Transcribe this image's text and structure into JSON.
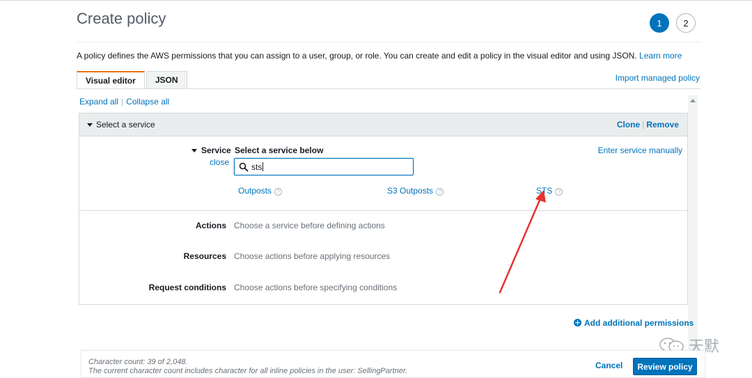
{
  "page": {
    "title": "Create policy",
    "steps": [
      "1",
      "2"
    ],
    "description": "A policy defines the AWS permissions that you can assign to a user, group, or role. You can create and edit a policy in the visual editor and using JSON.",
    "learn_more": "Learn more"
  },
  "tabs": {
    "visual": "Visual editor",
    "json": "JSON"
  },
  "import_link": "Import managed policy",
  "expand": {
    "expand_all": "Expand all",
    "separator": "|",
    "collapse_all": "Collapse all"
  },
  "panel": {
    "header_title": "Select a service",
    "clone": "Clone",
    "separator": "|",
    "remove": "Remove",
    "service_label": "Service",
    "close_link": "close",
    "select_below": "Select a service below",
    "enter_manually": "Enter service manually",
    "search_value": "sts",
    "results": [
      "Outposts",
      "S3 Outposts",
      "STS"
    ],
    "help_glyph": "?",
    "rows": [
      {
        "label": "Actions",
        "value": "Choose a service before defining actions"
      },
      {
        "label": "Resources",
        "value": "Choose actions before applying resources"
      },
      {
        "label": "Request conditions",
        "value": "Choose actions before specifying conditions"
      }
    ]
  },
  "add_permissions": "Add additional permissions",
  "footer": {
    "char_count": "Character count: 39 of 2,048.",
    "char_note": "The current character count includes character for all inline policies in the user: SellingPartner.",
    "cancel": "Cancel",
    "review": "Review policy"
  },
  "watermark": "天默",
  "colors": {
    "link": "#0073bb",
    "primary_button": "#0073bb",
    "tab_accent": "#ec7211",
    "annotation_arrow": "#e8322d"
  }
}
